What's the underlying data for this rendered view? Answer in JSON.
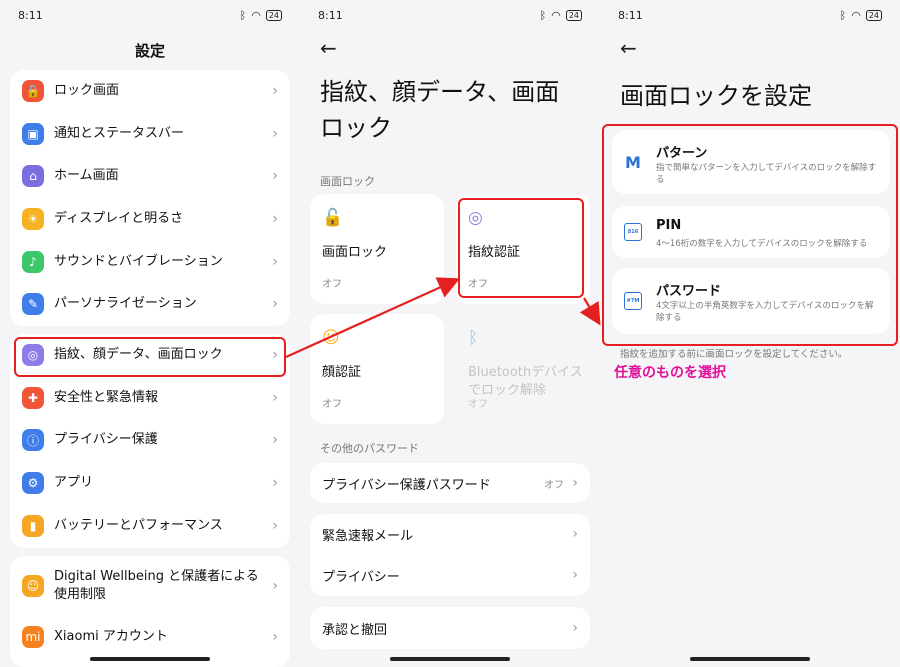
{
  "status": {
    "time": "8:11",
    "dots": "···",
    "battery": "24"
  },
  "panel1": {
    "title": "設定",
    "groups": [
      [
        {
          "label": "ロック画面",
          "color": "#f0553a",
          "glyph": "🔒"
        },
        {
          "label": "通知とステータスバー",
          "color": "#3f7ee8",
          "glyph": "▣"
        },
        {
          "label": "ホーム画面",
          "color": "#7b6fe0",
          "glyph": "⌂"
        },
        {
          "label": "ディスプレイと明るさ",
          "color": "#f5b323",
          "glyph": "☀"
        },
        {
          "label": "サウンドとバイブレーション",
          "color": "#3cc86a",
          "glyph": "♪"
        },
        {
          "label": "パーソナライゼーション",
          "color": "#3f7ee8",
          "glyph": "✎"
        }
      ],
      [
        {
          "label": "指紋、顔データ、画面ロック",
          "color": "#8e7de8",
          "glyph": "◎"
        },
        {
          "label": "安全性と緊急情報",
          "color": "#f0553a",
          "glyph": "✚"
        },
        {
          "label": "プライバシー保護",
          "color": "#3f7ee8",
          "glyph": "ⓘ"
        },
        {
          "label": "アプリ",
          "color": "#3f7ee8",
          "glyph": "⚙"
        },
        {
          "label": "バッテリーとパフォーマンス",
          "color": "#f5a623",
          "glyph": "▮"
        }
      ]
    ],
    "bottom": [
      {
        "label": "Digital Wellbeing と保護者による\n使用制限",
        "color": "#f5a623",
        "glyph": "☺"
      },
      {
        "label": "Xiaomi アカウント",
        "color": "#f58220",
        "glyph": "mi"
      }
    ]
  },
  "panel2": {
    "title": "指紋、顔データ、画面ロック",
    "section1": "画面ロック",
    "tiles": [
      {
        "name": "画面ロック",
        "value": "オフ",
        "glyph": "🔓"
      },
      {
        "name": "指紋認証",
        "value": "オフ",
        "glyph": "◎"
      },
      {
        "name": "顔認証",
        "value": "オフ",
        "glyph": "☺"
      },
      {
        "name": "Bluetoothデバイスでロック解除",
        "value": "オフ",
        "glyph": "ᛒ"
      }
    ],
    "section2": "その他のパスワード",
    "privacy_row": {
      "label": "プライバシー保護パスワード",
      "value": "オフ"
    },
    "rows": [
      "緊急速報メール",
      "プライバシー",
      "承認と撤回"
    ]
  },
  "panel3": {
    "title": "画面ロックを設定",
    "options": [
      {
        "title": "パターン",
        "desc": "指で簡単なパターンを入力してデバイスのロックを解除する",
        "icon_text": "M"
      },
      {
        "title": "PIN",
        "desc": "4〜16桁の数字を入力してデバイスのロックを解除する",
        "icon_text": "816"
      },
      {
        "title": "パスワード",
        "desc": "4文字以上の半角英数字を入力してデバイスのロックを解除する",
        "icon_text": "#7M"
      }
    ],
    "note": "指紋を追加する前に画面ロックを設定してください。",
    "annotation": "任意のものを選択"
  }
}
